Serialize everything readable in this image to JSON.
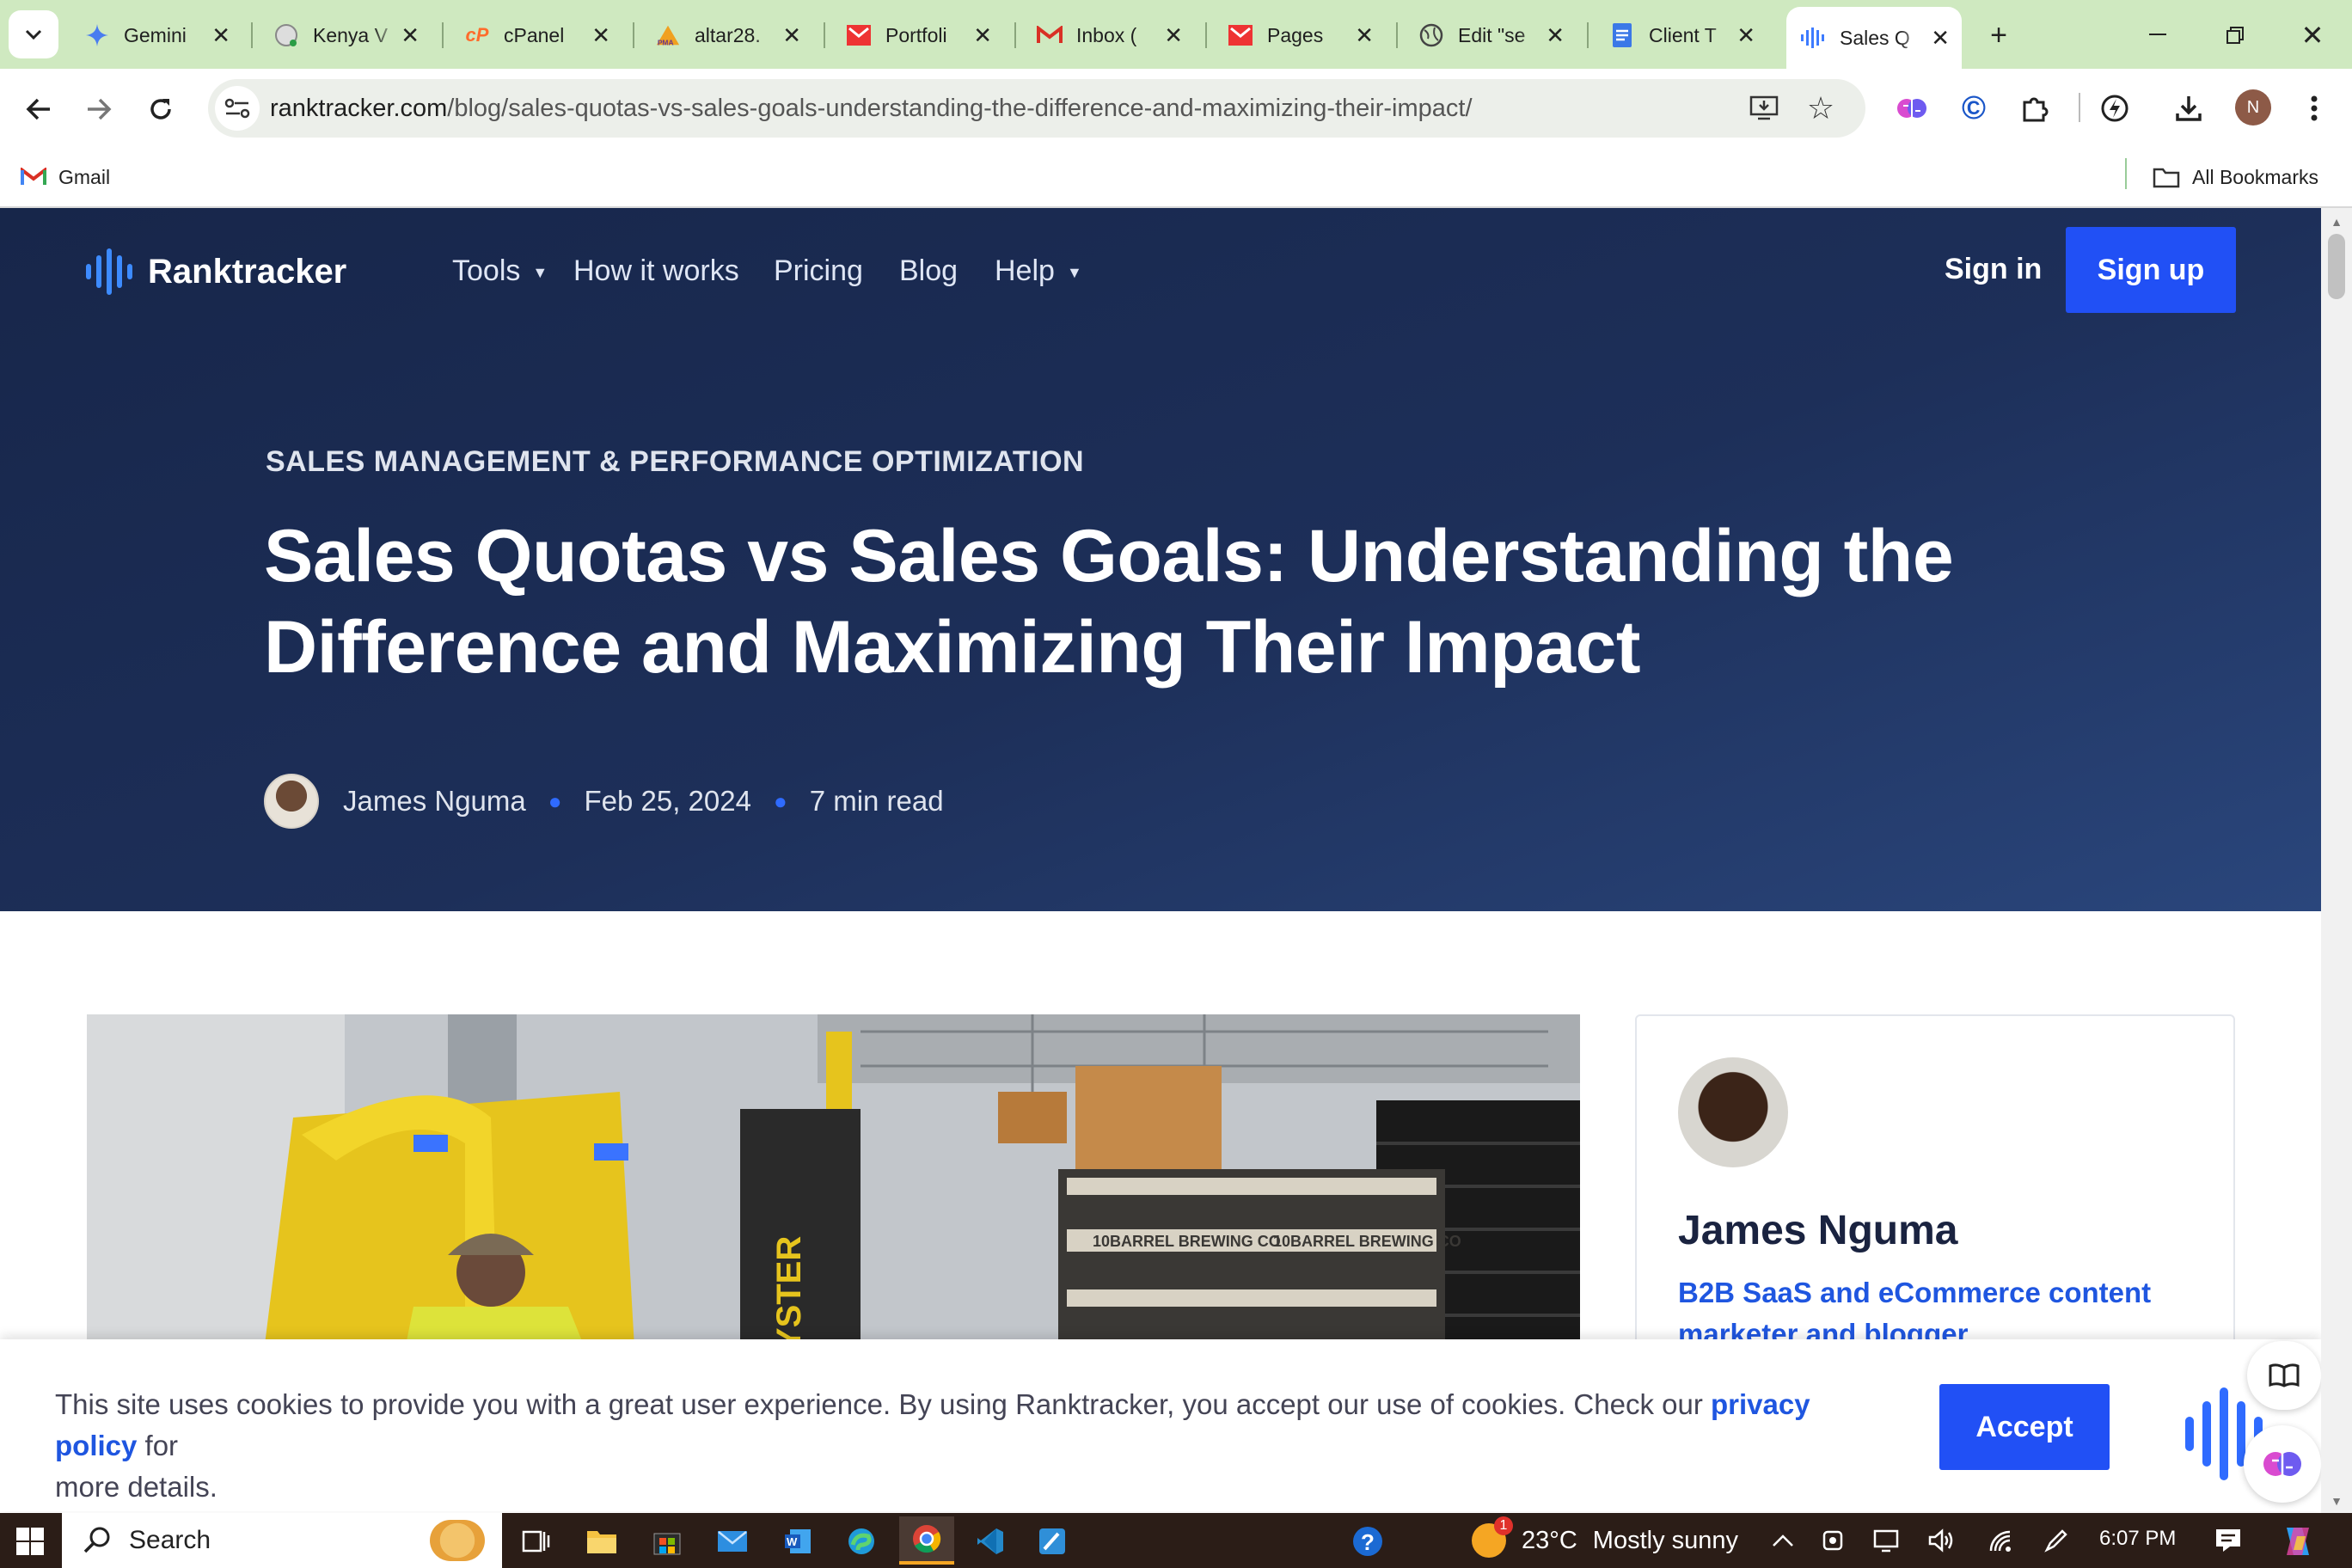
{
  "browser": {
    "tabs": [
      {
        "title": "Gemini",
        "icon": "gemini-icon"
      },
      {
        "title": "Kenya V",
        "icon": "globe-icon"
      },
      {
        "title": "cPanel",
        "icon": "cpanel-icon"
      },
      {
        "title": "altar28.",
        "icon": "pma-icon"
      },
      {
        "title": "Portfoli",
        "icon": "portfolio-icon"
      },
      {
        "title": "Inbox (",
        "icon": "gmail-icon"
      },
      {
        "title": "Pages",
        "icon": "portfolio-icon"
      },
      {
        "title": "Edit \"se",
        "icon": "globe-icon"
      },
      {
        "title": "Client T",
        "icon": "docs-icon"
      },
      {
        "title": "Sales Q",
        "icon": "ranktracker-icon"
      }
    ],
    "url_domain": "ranktracker.com",
    "url_path": "/blog/sales-quotas-vs-sales-goals-understanding-the-difference-and-maximizing-their-impact/",
    "bookmark_gmail": "Gmail",
    "bookmark_all": "All Bookmarks",
    "profile_initial": "N"
  },
  "site": {
    "logo": "Ranktracker",
    "nav": {
      "tools": "Tools",
      "how": "How it works",
      "pricing": "Pricing",
      "blog": "Blog",
      "help": "Help"
    },
    "sign_in": "Sign in",
    "sign_up": "Sign up"
  },
  "article": {
    "category": "SALES MANAGEMENT & PERFORMANCE OPTIMIZATION",
    "title_line1": "Sales Quotas vs Sales Goals: Understanding the",
    "title_line2": "Difference and Maximizing Their Impact",
    "author": "James Nguma",
    "date": "Feb 25, 2024",
    "read_time": "7 min read"
  },
  "author_card": {
    "name": "James Nguma",
    "bio_line1": "B2B SaaS and eCommerce content",
    "bio_line2": "marketer and blogger"
  },
  "image_text": {
    "forklift_brand": "HYSTER",
    "crate_label1": "10BARREL BREWING CO",
    "crate_label2": "10BARREL BREWING CO"
  },
  "cookie": {
    "text_before": "This site uses cookies to provide you with a great user experience. By using Ranktracker, you accept our use of cookies. Check our",
    "link": "privacy policy",
    "text_after": "for",
    "line2": "more details.",
    "accept": "Accept"
  },
  "taskbar": {
    "search": "Search",
    "weather_temp": "23°C",
    "weather_desc": "Mostly sunny",
    "weather_badge": "1",
    "time": "6:07 PM"
  },
  "colors": {
    "hero_bg": "#1d2f59",
    "accent": "#2150f5",
    "link": "#1f56e0",
    "tabbar": "#cfe9c0"
  }
}
